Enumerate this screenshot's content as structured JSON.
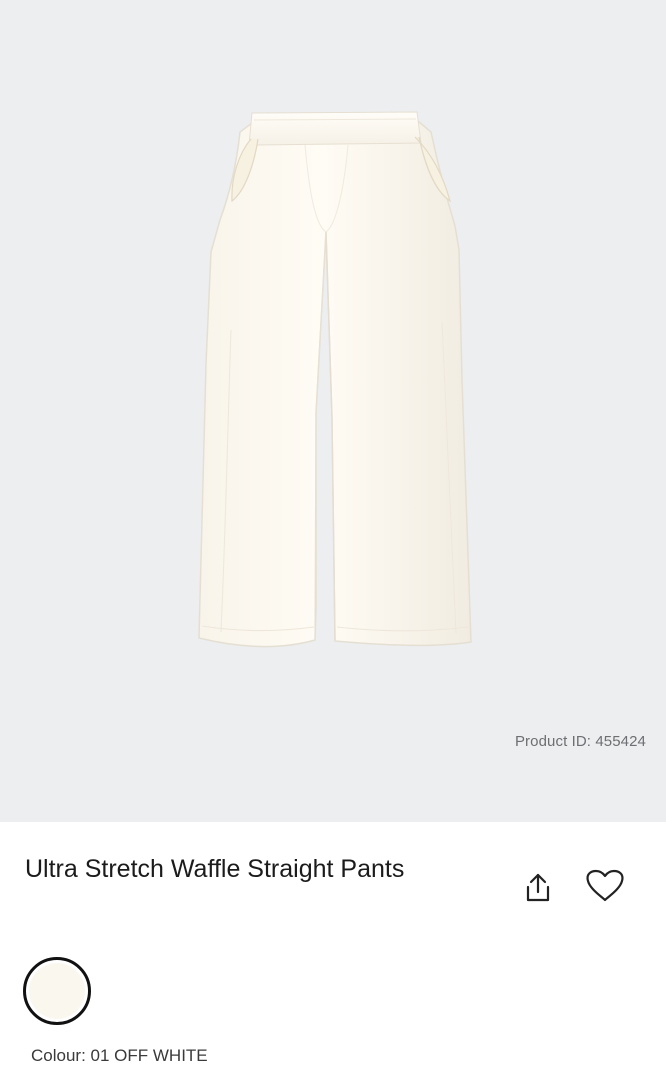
{
  "product": {
    "id_text": "Product ID: 455424",
    "title": "Ultra Stretch Waffle Straight Pants",
    "image_alt": "Off-white wide straight pants",
    "colour_text": "Colour: 01 OFF WHITE",
    "swatch_color": "#faf7ef"
  },
  "actions": {
    "share_icon": "share-icon",
    "favorite_icon": "heart-icon"
  },
  "colors": {
    "hero_background": "#eceef0",
    "text": "#1b1b1b",
    "muted_text": "#6d6f72"
  }
}
